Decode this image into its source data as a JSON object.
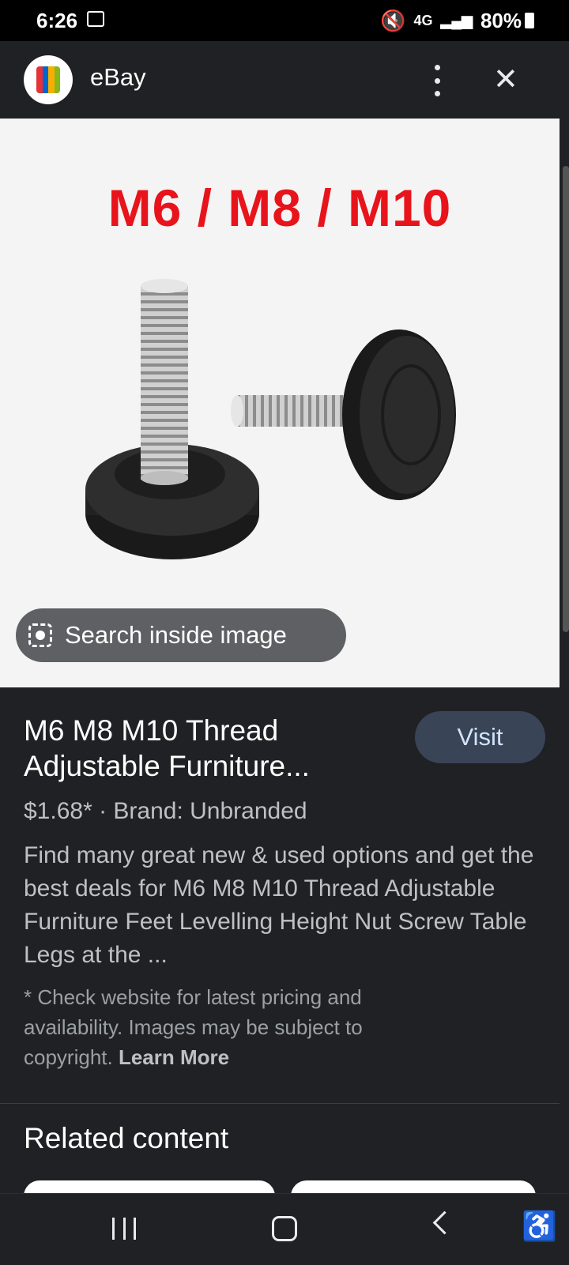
{
  "status_bar": {
    "time": "6:26",
    "network": "4G",
    "battery": "80%"
  },
  "app_bar": {
    "title": "eBay",
    "close_glyph": "✕"
  },
  "image": {
    "overlay_text": "M6 / M8 / M10",
    "search_inside_label": "Search inside image"
  },
  "product": {
    "title_line1": "M6 M8 M10 Thread",
    "title_line2": "Adjustable Furniture...",
    "visit_label": "Visit",
    "price": "$1.68*",
    "separator": " · ",
    "brand": "Brand: Unbranded",
    "description": "Find many great new & used options and get the best deals for M6 M8 M10 Thread Adjustable Furniture Feet Levelling Height Nut Screw Table Legs at the ...",
    "note_prefix": "* Check website for latest pricing and availability. Images may be subject to copyright.",
    "learn_more_label": "Learn More"
  },
  "related": {
    "heading": "Related content"
  },
  "colors": {
    "background": "#202124",
    "visit_button_bg": "#394457",
    "overlay_text_red": "#e8141b",
    "image_bg": "#f4f4f4"
  }
}
